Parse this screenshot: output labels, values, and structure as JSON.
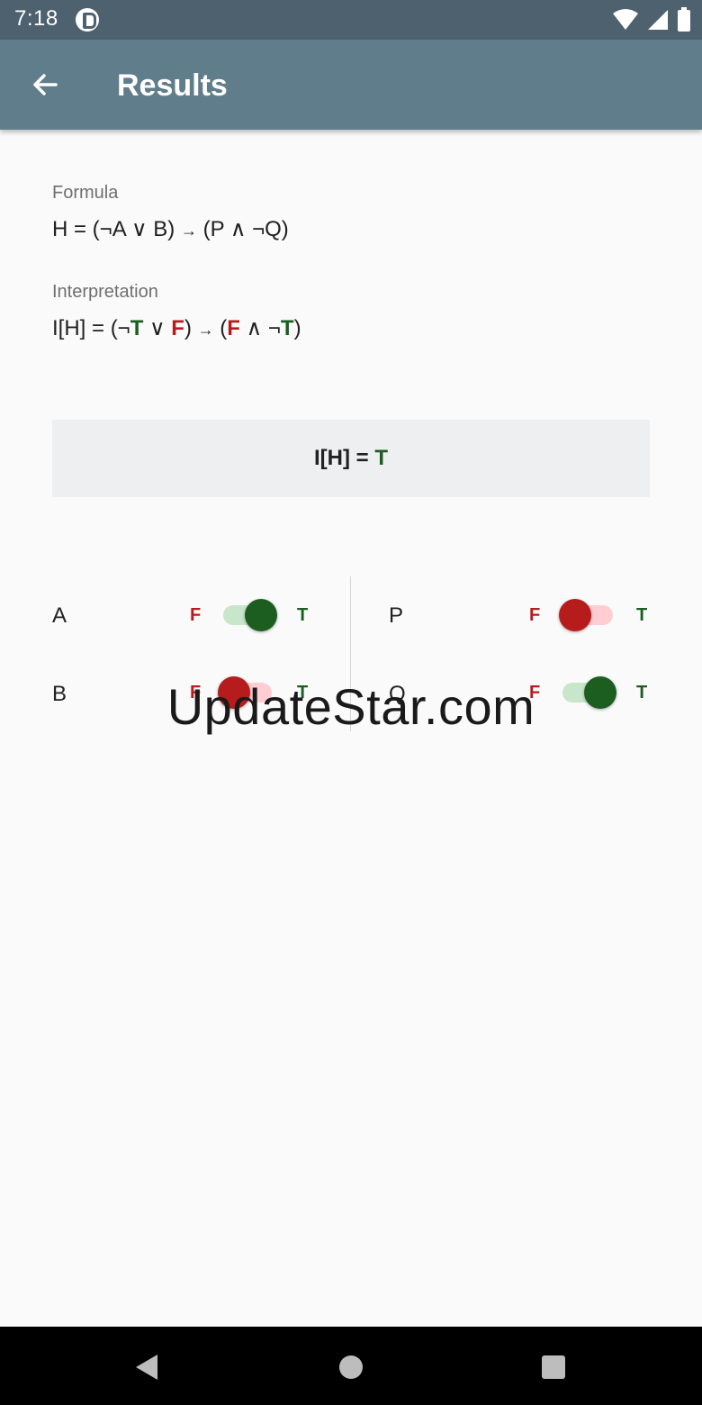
{
  "status_bar": {
    "time": "7:18"
  },
  "app_bar": {
    "title": "Results"
  },
  "formula": {
    "label": "Formula",
    "prefix": "H = (¬A ∨ B)",
    "arrow": "→",
    "suffix": "(P ∧ ¬Q)"
  },
  "interpretation": {
    "label": "Interpretation",
    "parts": {
      "p1": "I[H] = (¬",
      "v1": "T",
      "p2": " ∨ ",
      "v2": "F",
      "p3": ") ",
      "arrow": "→",
      "p4": " (",
      "v3": "F",
      "p5": " ∧ ¬",
      "v4": "T",
      "p6": ")"
    }
  },
  "result": {
    "prefix": "I[H] = ",
    "value": "T"
  },
  "variables": [
    {
      "name": "A",
      "false_label": "F",
      "true_label": "T",
      "value": true
    },
    {
      "name": "B",
      "false_label": "F",
      "true_label": "T",
      "value": false
    },
    {
      "name": "P",
      "false_label": "F",
      "true_label": "T",
      "value": false
    },
    {
      "name": "Q",
      "false_label": "F",
      "true_label": "T",
      "value": true
    }
  ],
  "watermark": "UpdateStar.com",
  "colors": {
    "true": "#1b5e20",
    "false": "#b71c1c",
    "app_bar": "#607d8b",
    "status_bar": "#4d616e"
  }
}
